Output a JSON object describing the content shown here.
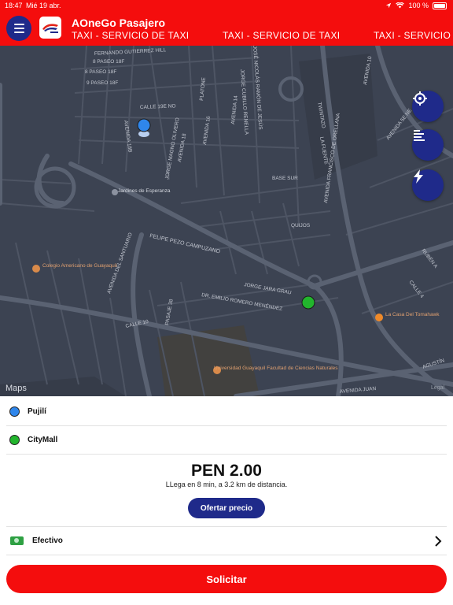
{
  "status_bar": {
    "time": "18:47",
    "date": "Mié 19 abr.",
    "battery": "100 %",
    "icons": [
      "location-arrow-icon",
      "wifi-icon",
      "battery-icon"
    ]
  },
  "header": {
    "menu_icon": "hamburger-menu-icon",
    "title": "AOneGo Pasajero",
    "marquee": [
      "TAXI - SERVICIO DE TAXI",
      "TAXI - SERVICIO DE TAXI",
      "TAXI - SERVICIO"
    ]
  },
  "map": {
    "labels": [
      "FERNANDO GUTIERREZ HILL",
      "8 PASEO 18F",
      "8 PASEO 18F",
      "9 PASEO 18F",
      "AVENIDA 18B",
      "CALLE 19E NO",
      "JORGE MAGNO OLIVERO",
      "AVENIDA 18",
      "AVENIDA 16",
      "AVENIDA 14",
      "PLATONE",
      "JOSÉ NICOLÁS RAMÓN DE JESÚS",
      "JORGE CUBILLO RENELLA",
      "TWINTAZO",
      "LA FUENTE",
      "AVENIDA FRANCISCO DE ORELLANA",
      "AVENIDA 10",
      "AVENIDA 5E NE",
      "BASE SUR",
      "Jardines de Esperanza",
      "FELIPE PEZO CAMPUZANO",
      "QUIJOS",
      "AVENIDA DEL SANTUARIO",
      "Colegio Americano de Guayaquil",
      "JORGE JARA GRAU",
      "DR. EMILIO ROMERO MENÉNDEZ",
      "PASAJE 38",
      "CALLE 10",
      "La Casa Del Tomahawk",
      "Universidad Guayaquil Facultad de Ciencias Naturales",
      "AVENIDA JUAN",
      "AGUSTÍN",
      "RUBÉN A",
      "CALLE 4"
    ],
    "brand": "Maps",
    "legal": "Legal",
    "buttons": [
      "locate-icon",
      "list-icon",
      "lightning-icon"
    ],
    "pickup_color": "#2f86eb",
    "destination_color": "#22b52d"
  },
  "trip": {
    "origin": "Pujilí",
    "destination": "CityMall",
    "origin_color": "#2f86eb",
    "destination_color": "#22b52d"
  },
  "fare": {
    "price": "PEN 2.00",
    "eta_text": "LLega en  8 min, a 3.2 km de distancia.",
    "offer_label": "Ofertar precio"
  },
  "payment": {
    "icon": "cash-icon",
    "label": "Efectivo"
  },
  "request_label": "Solicitar",
  "colors": {
    "brand_red": "#f40d0d",
    "navy": "#1f2a8a",
    "map_bg": "#3c4352",
    "road": "#5a6272"
  }
}
